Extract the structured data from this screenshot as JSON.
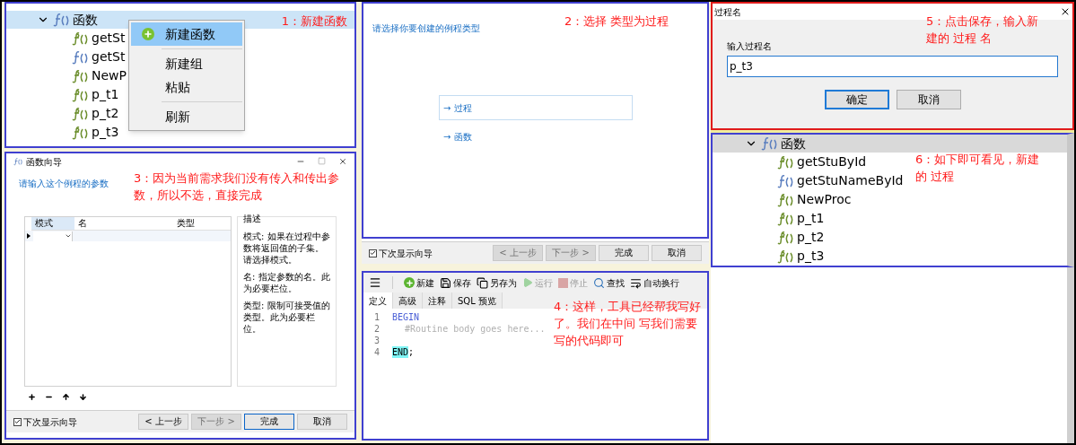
{
  "step1": {
    "annotation": "1：新建函数",
    "tree": {
      "label": "函数",
      "expanded": true,
      "children": [
        {
          "label": "getSt",
          "kind": "procedure"
        },
        {
          "label": "getSt",
          "kind": "function"
        },
        {
          "label": "NewP",
          "kind": "procedure"
        },
        {
          "label": "p_t1",
          "kind": "procedure"
        },
        {
          "label": "p_t2",
          "kind": "procedure"
        },
        {
          "label": "p_t3",
          "kind": "procedure"
        }
      ]
    },
    "menu": [
      {
        "kind": "item",
        "label": "新建函数",
        "selected": true
      },
      {
        "kind": "separator"
      },
      {
        "kind": "item",
        "label": "新建组",
        "selected": false
      },
      {
        "kind": "item",
        "label": "粘贴",
        "selected": false
      },
      {
        "kind": "separator"
      },
      {
        "kind": "item",
        "label": "刷新",
        "selected": false
      }
    ]
  },
  "step2": {
    "annotation": "2：选择 类型为过程",
    "prompt": "请选择你要创建的例程类型",
    "options": [
      {
        "arrow": "→",
        "label": "过程",
        "selected": true
      },
      {
        "arrow": "→",
        "label": "函数",
        "selected": false
      }
    ],
    "footer": {
      "checkbox": {
        "label": "下次显示向导",
        "checked": true
      },
      "buttons": [
        {
          "label": "< 上一步",
          "disabled": true,
          "focused": false
        },
        {
          "label": "下一步 >",
          "disabled": true,
          "focused": false
        },
        {
          "label": "完成",
          "disabled": false,
          "focused": false
        },
        {
          "label": "取消",
          "disabled": false,
          "focused": false
        }
      ]
    }
  },
  "step3": {
    "annotation": "3：因为当前需求我们没有传入和传出参数，所以不选，直接完成",
    "title": "函数向导",
    "prompt": "请输入这个例程的参数",
    "columns": [
      "模式",
      "名",
      "类型"
    ],
    "description": {
      "title": "描述",
      "paragraphs": [
        "模式: 如果在过程中参数将返回值的子集。请选择模式。",
        "名: 指定参数的名。此为必要栏位。",
        "类型: 限制可接受值的类型。此为必要栏位。"
      ]
    },
    "footer": {
      "checkbox": {
        "label": "下次显示向导",
        "checked": true
      },
      "buttons": [
        {
          "label": "< 上一步",
          "disabled": false,
          "focused": false
        },
        {
          "label": "下一步 >",
          "disabled": true,
          "focused": false
        },
        {
          "label": "完成",
          "disabled": false,
          "focused": true
        },
        {
          "label": "取消",
          "disabled": false,
          "focused": false
        }
      ]
    }
  },
  "step4": {
    "annotation": "4：这样，工具已经帮我写好了。我们在中间 写我们需要写的代码即可",
    "toolbar": [
      {
        "kind": "new",
        "label": "新建",
        "disabled": false
      },
      {
        "kind": "save",
        "label": "保存",
        "disabled": false
      },
      {
        "kind": "save_as",
        "label": "另存为",
        "disabled": false
      },
      {
        "kind": "run",
        "label": "运行",
        "disabled": true
      },
      {
        "kind": "stop",
        "label": "停止",
        "disabled": true
      },
      {
        "kind": "find",
        "label": "查找",
        "disabled": false
      },
      {
        "kind": "wrap",
        "label": "自动换行",
        "disabled": false
      }
    ],
    "tabs": [
      {
        "label": "定义",
        "selected": true
      },
      {
        "label": "高级",
        "selected": false
      },
      {
        "label": "注释",
        "selected": false
      },
      {
        "label": "SQL 预览",
        "selected": false
      }
    ],
    "lines": [
      {
        "number": "1",
        "segments": [
          {
            "text": "BEGIN",
            "kind": "keyword",
            "highlighted": false
          }
        ]
      },
      {
        "number": "2",
        "segments": [
          {
            "text": "#Routine body goes here...",
            "kind": "comment",
            "highlighted": false
          }
        ]
      },
      {
        "number": "3"
      },
      {
        "number": "4",
        "segments": [
          {
            "text": "END",
            "kind": "keyword",
            "highlighted": true
          },
          {
            "text": ";",
            "kind": "plain",
            "highlighted": false
          }
        ]
      }
    ]
  },
  "step5": {
    "annotation": "5：点击保存，输入新建的 过程 名",
    "title": "过程名",
    "label": "输入过程名",
    "value": "p_t3",
    "buttons": [
      {
        "label": "确定",
        "focused": true
      },
      {
        "label": "取消",
        "focused": false
      }
    ]
  },
  "step6": {
    "annotation": "6：如下即可看见，新建的 过程",
    "tree": {
      "label": "函数",
      "expanded": true,
      "children": [
        {
          "label": "getStuById",
          "kind": "procedure"
        },
        {
          "label": "getStuNameById",
          "kind": "function"
        },
        {
          "label": "NewProc",
          "kind": "procedure"
        },
        {
          "label": "p_t1",
          "kind": "procedure"
        },
        {
          "label": "p_t2",
          "kind": "procedure"
        },
        {
          "label": "p_t3",
          "kind": "procedure"
        }
      ]
    }
  }
}
